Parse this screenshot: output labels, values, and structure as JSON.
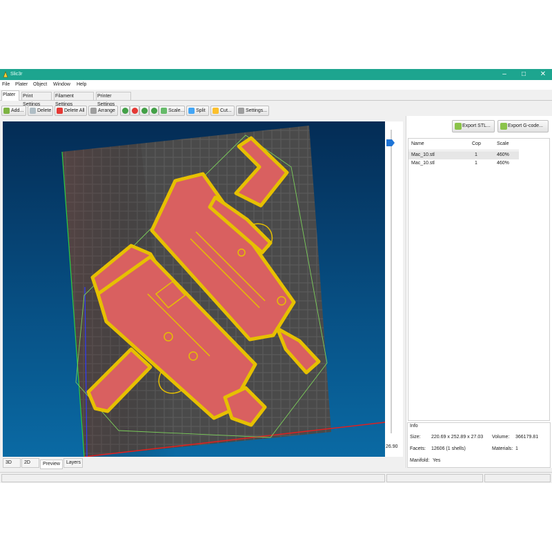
{
  "window": {
    "title": "Slic3r",
    "controls": [
      "–",
      "□",
      "✕"
    ]
  },
  "menu": [
    "File",
    "Plater",
    "Object",
    "Window",
    "Help"
  ],
  "tabs": [
    "Plater",
    "Print Settings",
    "Filament Settings",
    "Printer Settings"
  ],
  "active_tab": "Plater",
  "toolbar": {
    "add": "Add...",
    "delete": "Delete",
    "delete_all": "Delete All",
    "arrange": "Arrange",
    "scale": "Scale...",
    "split": "Split",
    "cut": "Cut...",
    "settings": "Settings..."
  },
  "export": {
    "stl": "Export STL...",
    "gcode": "Export G-code..."
  },
  "object_list": {
    "columns": [
      "Name",
      "Cop",
      "Scale"
    ],
    "rows": [
      {
        "name": "Mac_10.stl",
        "copies": "1",
        "scale": "460%"
      },
      {
        "name": "Mac_10.stl",
        "copies": "1",
        "scale": "460%"
      }
    ]
  },
  "layer_slider": {
    "value": "26.90"
  },
  "view_tabs": [
    "3D",
    "2D",
    "Preview",
    "Layers"
  ],
  "active_view_tab": "Preview",
  "info": {
    "title": "Info",
    "size_label": "Size:",
    "size": "220.69 x 252.89 x 27.03",
    "volume_label": "Volume:",
    "volume": "366179.81",
    "facets_label": "Facets:",
    "facets": "12606 (1 shells)",
    "materials_label": "Materials:",
    "materials": "1",
    "manifold_label": "Manifold:",
    "manifold": "Yes"
  },
  "colors": {
    "titlebar": "#1da58f",
    "model_fill": "#d96060",
    "model_perimeter": "#e6c000",
    "viewport_top": "#042c55",
    "viewport_bottom": "#0a6aa4",
    "bed_grid": "#5c5c5c"
  }
}
